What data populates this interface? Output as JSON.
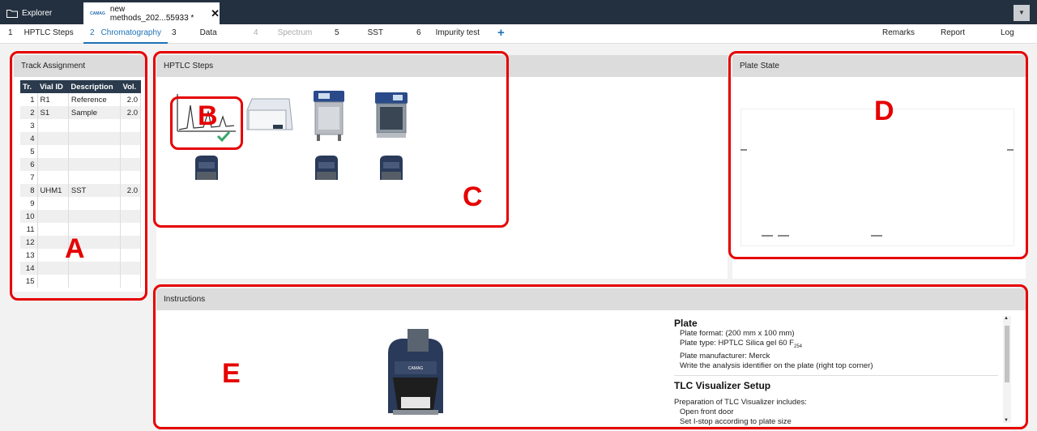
{
  "titlebar": {
    "explorer_label": "Explorer",
    "active_tab_logo": "CAMAG",
    "active_tab_label": "new methods_202...55933 *",
    "close_glyph": "✕",
    "dropdown_glyph": "▼"
  },
  "steps": [
    {
      "num": "1",
      "label": "HPTLC Steps",
      "state": "normal"
    },
    {
      "num": "2",
      "label": "Chromatography",
      "state": "active"
    },
    {
      "num": "3",
      "label": "Data",
      "state": "normal"
    },
    {
      "num": "4",
      "label": "Spectrum",
      "state": "disabled"
    },
    {
      "num": "5",
      "label": "SST",
      "state": "normal"
    },
    {
      "num": "6",
      "label": "Impurity test",
      "state": "normal"
    }
  ],
  "add_step_glyph": "+",
  "right_links": {
    "remarks": "Remarks",
    "report": "Report",
    "log": "Log"
  },
  "track_assignment": {
    "title": "Track Assignment",
    "columns": [
      "Tr.",
      "Vial ID",
      "Description",
      "Vol."
    ],
    "rows": [
      {
        "tr": "1",
        "vial": "R1",
        "desc": "Reference",
        "vol": "2.0"
      },
      {
        "tr": "2",
        "vial": "S1",
        "desc": "Sample",
        "vol": "2.0"
      },
      {
        "tr": "3",
        "vial": "",
        "desc": "",
        "vol": ""
      },
      {
        "tr": "4",
        "vial": "",
        "desc": "",
        "vol": ""
      },
      {
        "tr": "5",
        "vial": "",
        "desc": "",
        "vol": ""
      },
      {
        "tr": "6",
        "vial": "",
        "desc": "",
        "vol": ""
      },
      {
        "tr": "7",
        "vial": "",
        "desc": "",
        "vol": ""
      },
      {
        "tr": "8",
        "vial": "UHM1",
        "desc": "SST",
        "vol": "2.0"
      },
      {
        "tr": "9",
        "vial": "",
        "desc": "",
        "vol": ""
      },
      {
        "tr": "10",
        "vial": "",
        "desc": "",
        "vol": ""
      },
      {
        "tr": "11",
        "vial": "",
        "desc": "",
        "vol": ""
      },
      {
        "tr": "12",
        "vial": "",
        "desc": "",
        "vol": ""
      },
      {
        "tr": "13",
        "vial": "",
        "desc": "",
        "vol": ""
      },
      {
        "tr": "14",
        "vial": "",
        "desc": "",
        "vol": ""
      },
      {
        "tr": "15",
        "vial": "",
        "desc": "",
        "vol": ""
      }
    ]
  },
  "hptlc_steps": {
    "title": "HPTLC Steps"
  },
  "plate_state": {
    "title": "Plate State"
  },
  "instructions": {
    "title": "Instructions",
    "plate": {
      "heading": "Plate",
      "format": "Plate format: (200 mm x 100 mm)",
      "type_main": "Plate type: HPTLC Silica gel 60 F",
      "type_sub": "254",
      "manufacturer": "Plate manufacturer: Merck",
      "note": "Write the analysis identifier on the plate (right top corner)"
    },
    "visualizer": {
      "heading": "TLC Visualizer Setup",
      "intro": "Preparation of TLC Visualizer includes:",
      "step1": "Open front door",
      "step2": "Set I-stop according to plate size"
    },
    "device_label": "CAMAG"
  },
  "annotations": {
    "A": "A",
    "B": "B",
    "C": "C",
    "D": "D",
    "E": "E"
  },
  "colors": {
    "accent": "#1f73b7",
    "titlebar": "#23303f",
    "annotation": "#e60000",
    "check": "#3aa56b"
  }
}
